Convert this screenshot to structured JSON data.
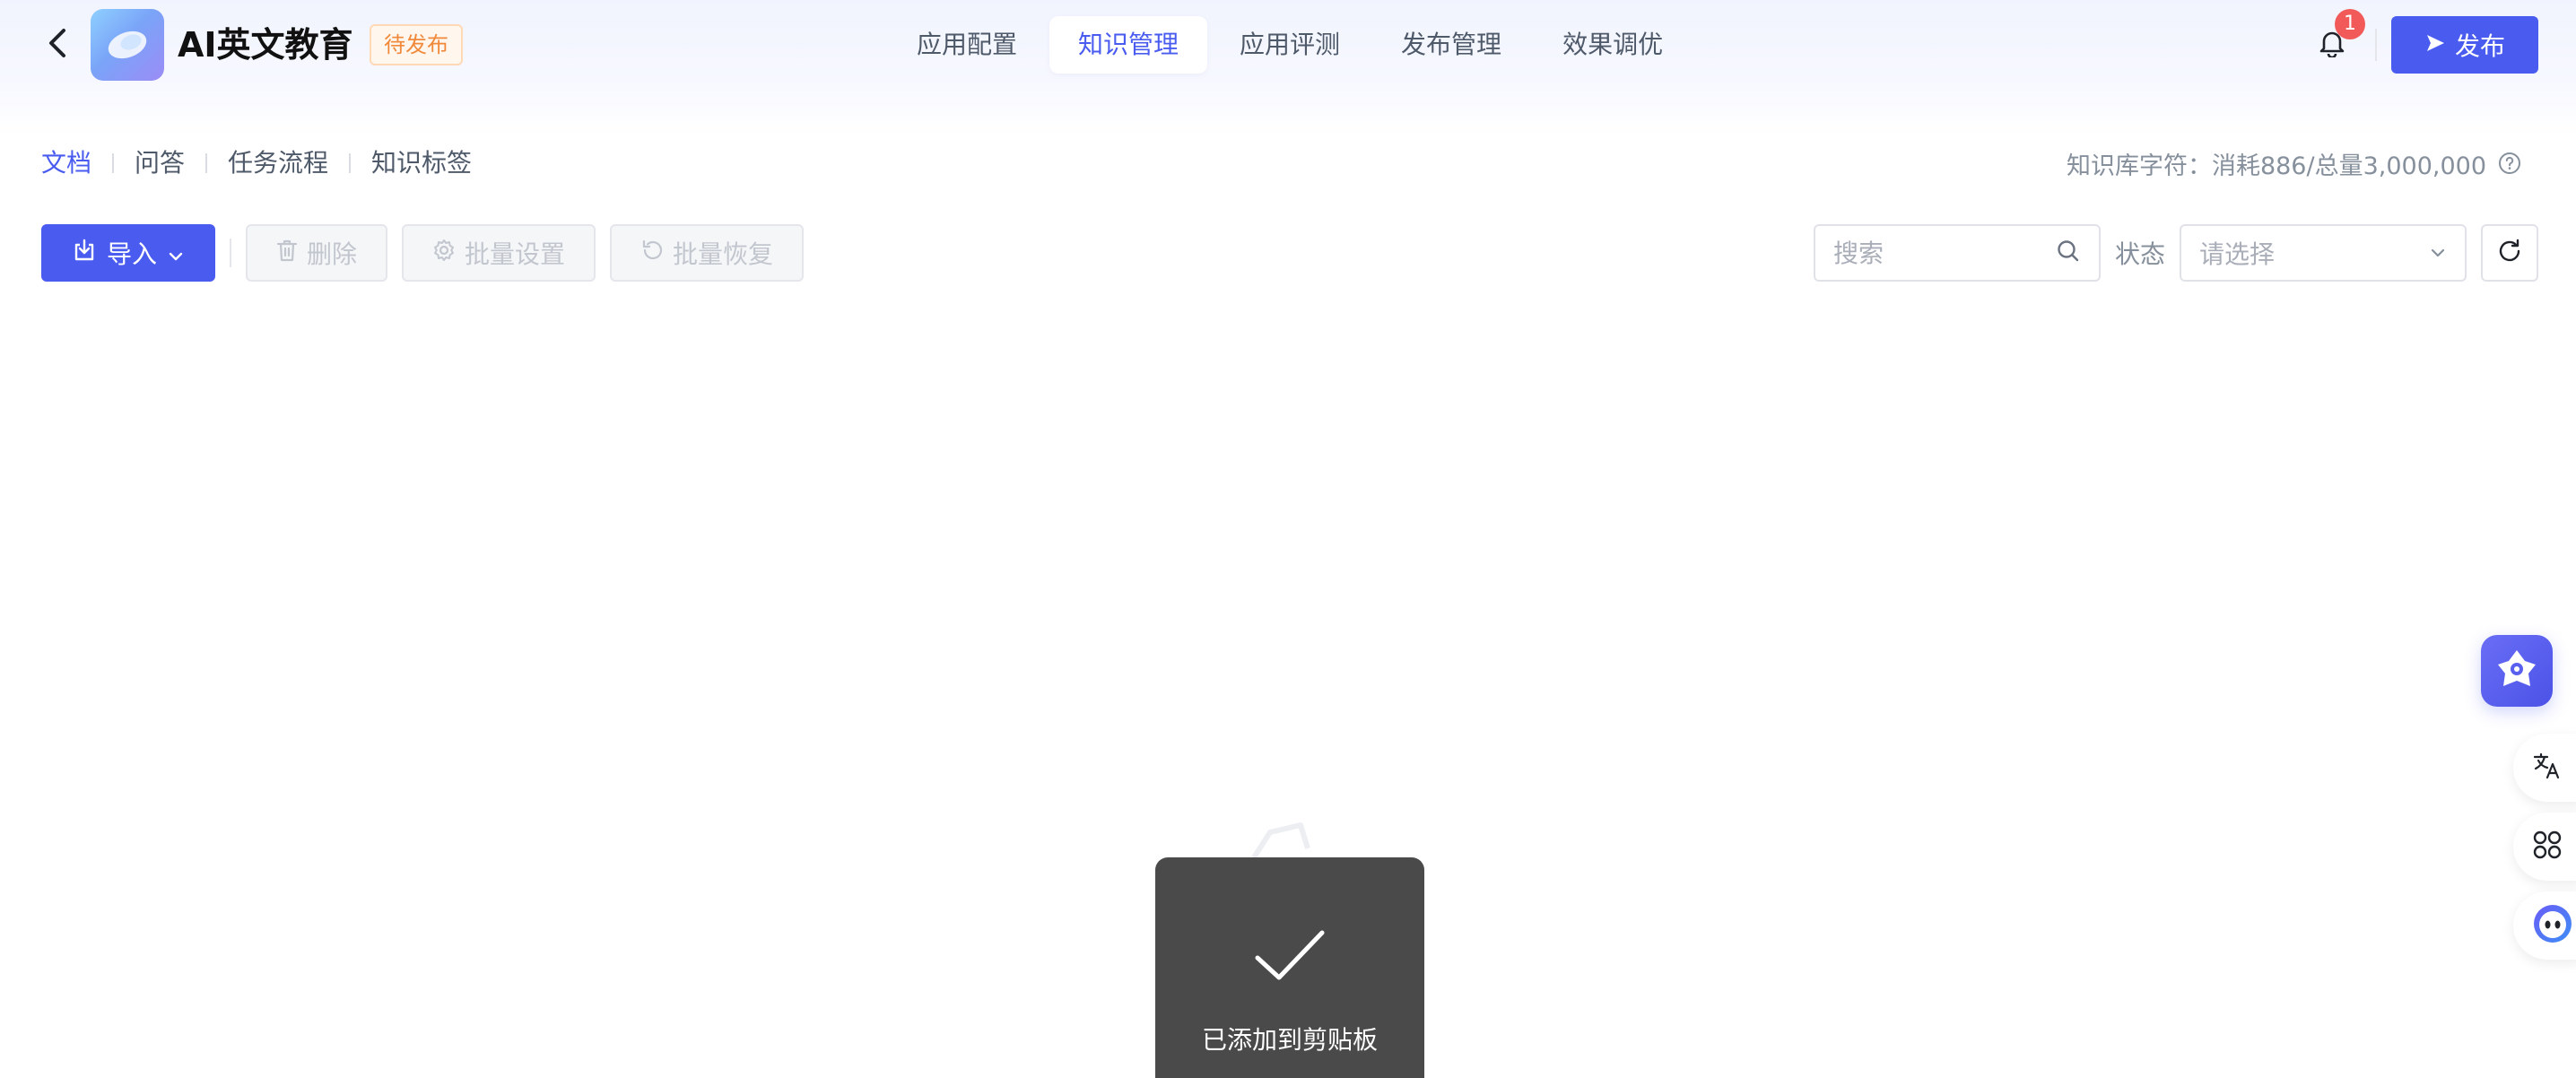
{
  "header": {
    "app_title": "AI英文教育",
    "status_tag": "待发布",
    "tabs": [
      {
        "label": "应用配置",
        "active": false
      },
      {
        "label": "知识管理",
        "active": true
      },
      {
        "label": "应用评测",
        "active": false
      },
      {
        "label": "发布管理",
        "active": false
      },
      {
        "label": "效果调优",
        "active": false
      }
    ],
    "notification_count": "1",
    "publish_label": "发布"
  },
  "subnav": {
    "tabs": [
      {
        "label": "文档",
        "active": true
      },
      {
        "label": "问答",
        "active": false
      },
      {
        "label": "任务流程",
        "active": false
      },
      {
        "label": "知识标签",
        "active": false
      }
    ],
    "quota_text": "知识库字符：消耗886/总量3,000,000"
  },
  "toolbar": {
    "import_label": "导入",
    "delete_label": "删除",
    "batch_settings_label": "批量设置",
    "batch_restore_label": "批量恢复"
  },
  "filters": {
    "search_placeholder": "搜索",
    "status_label": "状态",
    "status_placeholder": "请选择"
  },
  "toast": {
    "message": "已添加到剪贴板"
  },
  "colors": {
    "primary": "#4a5cf0",
    "badge": "#f25a5a",
    "status_tag": "#f08a3a",
    "toast_bg": "#4a4a4a"
  },
  "icons": {
    "back": "chevron-left-icon",
    "notification": "bell-icon",
    "publish": "send-icon",
    "import": "import-icon",
    "delete": "trash-icon",
    "settings": "gear-icon",
    "restore": "undo-icon",
    "search": "search-icon",
    "dropdown": "chevron-down-icon",
    "refresh": "refresh-icon",
    "help": "help-circle-icon",
    "toast": "check-icon",
    "assistant": "assistant-logo-icon",
    "translate": "translate-icon",
    "apps": "apps-grid-icon",
    "bot": "bot-face-icon"
  }
}
